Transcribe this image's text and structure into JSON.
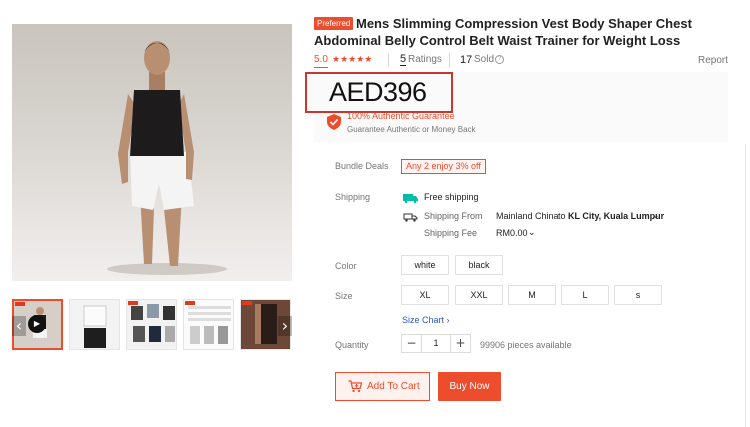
{
  "product": {
    "badge": "Preferred",
    "title": "Mens Slimming Compression Vest Body Shaper Chest Abdominal Belly Control Belt Waist Trainer for Weight Loss",
    "rating_score": "5.0",
    "rating_stars": 5,
    "ratings_count": "5",
    "ratings_label": "Ratings",
    "sold_count": "17",
    "sold_label": "Sold",
    "report_label": "Report",
    "price": "AED396",
    "guarantee_title": "100% Authentic Guarantee",
    "guarantee_subtitle": "Guarantee Authentic or Money Back"
  },
  "bundle": {
    "label": "Bundle Deals",
    "deal": "Any 2 enjoy 3% off"
  },
  "shipping": {
    "label": "Shipping",
    "free_shipping": "Free shipping",
    "from_label": "Shipping From",
    "from_value": "Mainland China",
    "to_word": "to",
    "destination": "KL City, Kuala Lumpur",
    "fee_label": "Shipping Fee",
    "fee_value": "RM0.00"
  },
  "color": {
    "label": "Color",
    "options": [
      "white",
      "black"
    ]
  },
  "size": {
    "label": "Size",
    "options": [
      "XL",
      "XXL",
      "M",
      "L",
      "s"
    ],
    "chart_link": "Size Chart"
  },
  "quantity": {
    "label": "Quantity",
    "minus": "−",
    "value": "1",
    "plus": "+",
    "stock": "99906 pieces available"
  },
  "actions": {
    "add_to_cart": "Add To Cart",
    "buy_now": "Buy Now"
  },
  "icons": {
    "prev": "chevron-left-icon",
    "next": "chevron-right-icon",
    "play": "play-icon",
    "help": "help-circle-icon",
    "shield": "shield-check-icon",
    "free_ship": "free-shipping-truck-icon",
    "ship_from": "delivery-truck-icon",
    "cart": "cart-plus-icon"
  },
  "colors": {
    "accent": "#ee4d2d",
    "highlight_box": "#c9362b",
    "link": "#2f59bd"
  }
}
